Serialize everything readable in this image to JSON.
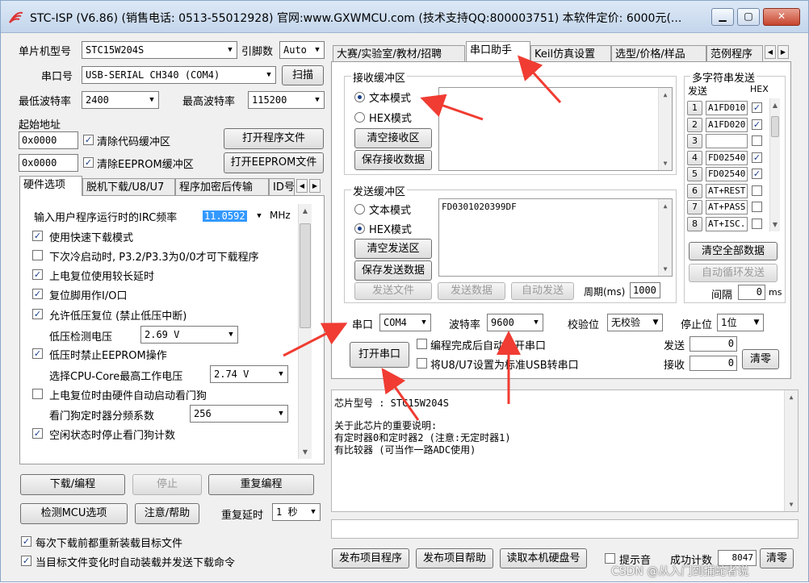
{
  "window": {
    "title": "STC-ISP (V6.86) (销售电话: 0513-55012928) 官网:www.GXWMCU.com  (技术支持QQ:800003751) 本软件定价: 6000元(...",
    "min_label": "▁",
    "max_label": "▢",
    "close_label": "✕"
  },
  "left": {
    "mcu_type_label": "单片机型号",
    "mcu_type_value": "STC15W204S",
    "pins_label": "引脚数",
    "pins_value": "Auto",
    "port_label": "串口号",
    "port_value": "USB-SERIAL CH340 (COM4)",
    "scan_button": "扫描",
    "min_baud_label": "最低波特率",
    "min_baud_value": "2400",
    "max_baud_label": "最高波特率",
    "max_baud_value": "115200",
    "start_addr_label": "起始地址",
    "code_addr": "0x0000",
    "clear_code_label": "清除代码缓冲区",
    "open_prog_button": "打开程序文件",
    "eeprom_addr": "0x0000",
    "clear_eeprom_label": "清除EEPROM缓冲区",
    "open_eeprom_button": "打开EEPROM文件",
    "tabs": [
      "硬件选项",
      "脱机下载/U8/U7",
      "程序加密后传输",
      "ID号"
    ],
    "hw": {
      "irc_label": "输入用户程序运行时的IRC频率",
      "irc_value": "11.0592",
      "irc_unit": "MHz",
      "opt1": "使用快速下载模式",
      "opt2": "下次冷启动时, P3.2/P3.3为0/0才可下载程序",
      "opt3": "上电复位使用较长延时",
      "opt4": "复位脚用作I/O口",
      "opt5": "允许低压复位 (禁止低压中断)",
      "lv_label": "低压检测电压",
      "lv_value": "2.69 V",
      "opt6": "低压时禁止EEPROM操作",
      "core_label": "选择CPU-Core最高工作电压",
      "core_value": "2.74 V",
      "opt7": "上电复位时由硬件自动启动看门狗",
      "wdt_label": "看门狗定时器分频系数",
      "wdt_value": "256",
      "opt8": "空闲状态时停止看门狗计数"
    },
    "download_button": "下载/编程",
    "stop_button": "停止",
    "repeat_button": "重复编程",
    "detect_button": "检测MCU选项",
    "help_button": "注意/帮助",
    "repeat_delay_label": "重复延时",
    "repeat_delay_value": "1 秒",
    "reload_label": "每次下载前都重新装载目标文件",
    "autoload_label": "当目标文件变化时自动装载并发送下载命令"
  },
  "right": {
    "tabs": [
      "大赛/实验室/教材/招聘",
      "串口助手",
      "Keil仿真设置",
      "选型/价格/样品",
      "范例程序"
    ],
    "recv": {
      "group_title": "接收缓冲区",
      "text_mode": "文本模式",
      "hex_mode": "HEX模式",
      "clear_button": "清空接收区",
      "save_button": "保存接收数据"
    },
    "send": {
      "group_title": "发送缓冲区",
      "text_mode": "文本模式",
      "hex_mode": "HEX模式",
      "clear_button": "清空发送区",
      "save_button": "保存发送数据",
      "content": "FD0301020399DF"
    },
    "send_file_button": "发送文件",
    "send_data_button": "发送数据",
    "auto_send_button": "自动发送",
    "period_label": "周期(ms)",
    "period_value": "1000",
    "multi": {
      "group_title": "多字符串发送",
      "send_header": "发送",
      "hex_header": "HEX",
      "rows": [
        {
          "num": "1",
          "text": "A1FD010"
        },
        {
          "num": "2",
          "text": "A1FD020"
        },
        {
          "num": "3",
          "text": ""
        },
        {
          "num": "4",
          "text": "FD02540"
        },
        {
          "num": "5",
          "text": "FD02540"
        },
        {
          "num": "6",
          "text": "AT+REST"
        },
        {
          "num": "7",
          "text": "AT+PASS"
        },
        {
          "num": "8",
          "text": "AT+ISC."
        }
      ],
      "clear_all_button": "清空全部数据",
      "auto_loop_button": "自动循环发送",
      "interval_label": "间隔",
      "interval_value": "0",
      "interval_unit": "ms"
    },
    "serial": {
      "port_label": "串口",
      "port_value": "COM4",
      "baud_label": "波特率",
      "baud_value": "9600",
      "parity_label": "校验位",
      "parity_value": "无校验",
      "stop_label": "停止位",
      "stop_value": "1位",
      "open_button": "打开串口",
      "auto_open_label": "编程完成后自动打开串口",
      "u8_label": "将U8/U7设置为标准USB转串口",
      "sent_label": "发送",
      "sent_value": "0",
      "recv_label": "接收",
      "recv_value": "0",
      "clear_button": "清零"
    },
    "info": {
      "chip_line": "芯片型号 : STC15W204S",
      "line1": "关于此芯片的重要说明:",
      "line2": "  有定时器0和定时器2 (注意:无定时器1)",
      "line3": "  有比较器 (可当作一路ADC使用)"
    },
    "bottom": {
      "publish_prog_button": "发布项目程序",
      "publish_help_button": "发布项目帮助",
      "read_disk_button": "读取本机硬盘号",
      "beep_label": "提示音",
      "success_label": "成功计数",
      "success_value": "8047",
      "clear_button": "清零"
    }
  },
  "watermark": "CSDN @从入门到捕蛇者说",
  "colors": {
    "arrow": "#f03c32",
    "selection": "#3399ff",
    "check": "#1a3f8a"
  }
}
